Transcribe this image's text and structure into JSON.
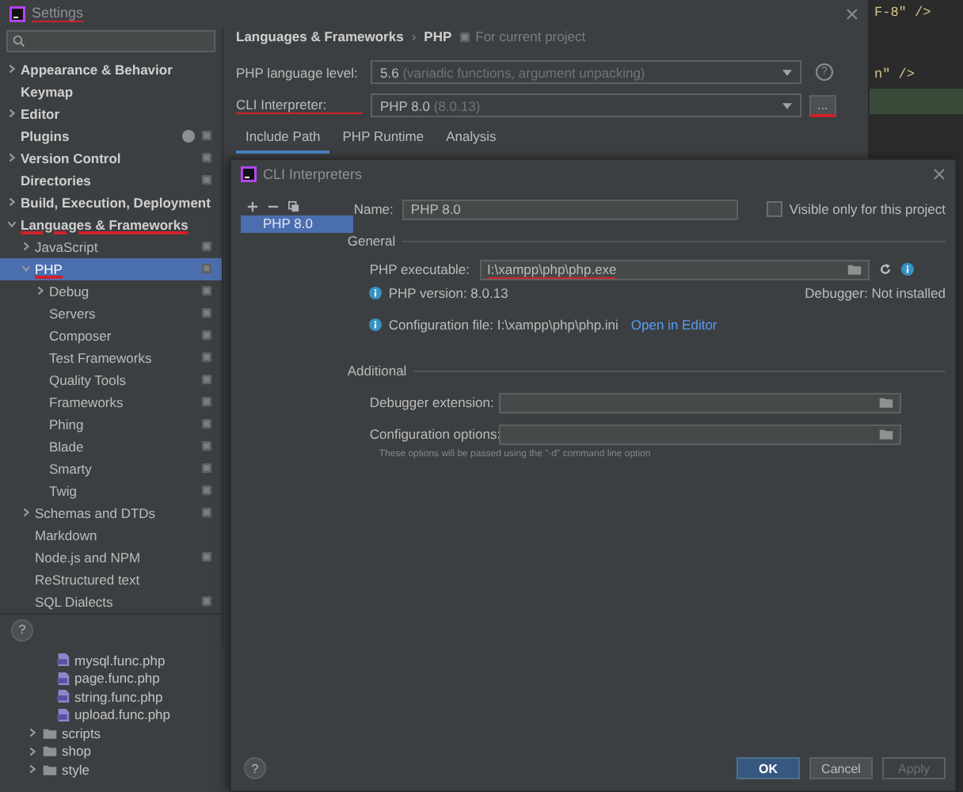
{
  "settings": {
    "title": "Settings",
    "title_marked": true,
    "sidebar": {
      "items": [
        {
          "label": "Appearance & Behavior",
          "expanded": false,
          "selected": false,
          "project_level": false,
          "marked": false
        },
        {
          "label": "Keymap",
          "selected": false,
          "project_level": false,
          "marked": false
        },
        {
          "label": "Editor",
          "expanded": false,
          "selected": false,
          "project_level": false,
          "marked": false
        },
        {
          "label": "Plugins",
          "badge": true,
          "selected": false,
          "project_level": true,
          "marked": false
        },
        {
          "label": "Version Control",
          "expanded": false,
          "selected": false,
          "project_level": true,
          "marked": false
        },
        {
          "label": "Directories",
          "selected": false,
          "project_level": true,
          "marked": false
        },
        {
          "label": "Build, Execution, Deployment",
          "expanded": false,
          "selected": false,
          "project_level": false,
          "marked": false
        },
        {
          "label": "Languages & Frameworks",
          "expanded": true,
          "selected": false,
          "project_level": false,
          "marked": true,
          "children": [
            {
              "label": "JavaScript",
              "expanded": false,
              "selected": false,
              "project_level": true,
              "marked": false
            },
            {
              "label": "PHP",
              "expanded": true,
              "selected": true,
              "project_level": true,
              "marked": true,
              "children": [
                {
                  "label": "Debug",
                  "expanded": false,
                  "selected": false,
                  "project_level": true,
                  "marked": false
                },
                {
                  "label": "Servers",
                  "selected": false,
                  "project_level": true,
                  "marked": false
                },
                {
                  "label": "Composer",
                  "selected": false,
                  "project_level": true,
                  "marked": false
                },
                {
                  "label": "Test Frameworks",
                  "selected": false,
                  "project_level": true,
                  "marked": false
                },
                {
                  "label": "Quality Tools",
                  "selected": false,
                  "project_level": true,
                  "marked": false
                },
                {
                  "label": "Frameworks",
                  "selected": false,
                  "project_level": true,
                  "marked": false
                },
                {
                  "label": "Phing",
                  "selected": false,
                  "project_level": true,
                  "marked": false
                },
                {
                  "label": "Blade",
                  "selected": false,
                  "project_level": true,
                  "marked": false
                },
                {
                  "label": "Smarty",
                  "selected": false,
                  "project_level": true,
                  "marked": false
                },
                {
                  "label": "Twig",
                  "selected": false,
                  "project_level": true,
                  "marked": false
                }
              ]
            },
            {
              "label": "Schemas and DTDs",
              "expanded": false,
              "selected": false,
              "project_level": true,
              "marked": false
            },
            {
              "label": "Markdown",
              "selected": false,
              "project_level": false,
              "marked": false
            },
            {
              "label": "Node.js and NPM",
              "selected": false,
              "project_level": true,
              "marked": false
            },
            {
              "label": "ReStructured text",
              "selected": false,
              "project_level": false,
              "marked": false
            },
            {
              "label": "SQL Dialects",
              "selected": false,
              "project_level": true,
              "marked": false
            }
          ]
        }
      ]
    },
    "help_label": "?",
    "breadcrumb": [
      "Languages & Frameworks",
      "PHP"
    ],
    "separator": "›",
    "scope_note": "For current project",
    "fields": [
      {
        "kind": "dropdown-help",
        "label": "PHP language level:",
        "value": "5.6",
        "hint": "(variadic functions, argument unpacking)",
        "help": "?",
        "marked": false
      },
      {
        "kind": "dropdown-more",
        "label": "CLI Interpreter:",
        "value": "PHP 8.0",
        "hint": "(8.0.13)",
        "button": "...",
        "marked": true
      }
    ],
    "tabs": [
      {
        "label": "Include Path",
        "selected": true
      },
      {
        "label": "PHP Runtime",
        "selected": false
      },
      {
        "label": "Analysis",
        "selected": false
      }
    ]
  },
  "editor": {
    "lines": [
      {
        "kind": "code",
        "text": "F-8\" />"
      },
      {
        "kind": "blank"
      },
      {
        "kind": "blank"
      },
      {
        "kind": "code",
        "text": "n\" />"
      },
      {
        "kind": "highlight"
      }
    ]
  },
  "project_tree": {
    "items": [
      {
        "kind": "php-file",
        "label": "mysql.func.php"
      },
      {
        "kind": "php-file",
        "label": "page.func.php"
      },
      {
        "kind": "php-file",
        "label": "string.func.php"
      },
      {
        "kind": "php-file",
        "label": "upload.func.php"
      },
      {
        "kind": "folder",
        "label": "scripts",
        "expanded": false
      },
      {
        "kind": "folder",
        "label": "shop",
        "expanded": false
      },
      {
        "kind": "folder",
        "label": "style",
        "expanded": false
      }
    ]
  },
  "cli_dialog": {
    "title": "CLI Interpreters",
    "interpreters": [
      {
        "label": "PHP 8.0",
        "selected": true
      }
    ],
    "name_label": "Name:",
    "name_value": "PHP 8.0",
    "visible_only": {
      "label": "Visible only for this project",
      "checked": false
    },
    "general_title": "General",
    "executable_label": "PHP executable:",
    "executable_value": "I:\\xampp\\php\\php.exe",
    "executable_marked": true,
    "php_version": "PHP version: 8.0.13",
    "debugger": "Debugger: Not installed",
    "config_file": "Configuration file: I:\\xampp\\php\\php.ini",
    "open_link": "Open in Editor",
    "additional_title": "Additional",
    "debugger_extension_label": "Debugger extension:",
    "config_options_label": "Configuration options:",
    "options_hint": "These options will be passed using the \"-d\" command line option",
    "help_label": "?",
    "buttons": [
      {
        "kind": "primary",
        "label": "OK",
        "disabled": false
      },
      {
        "kind": "normal",
        "label": "Cancel",
        "disabled": false
      },
      {
        "kind": "normal",
        "label": "Apply",
        "disabled": true
      }
    ]
  }
}
